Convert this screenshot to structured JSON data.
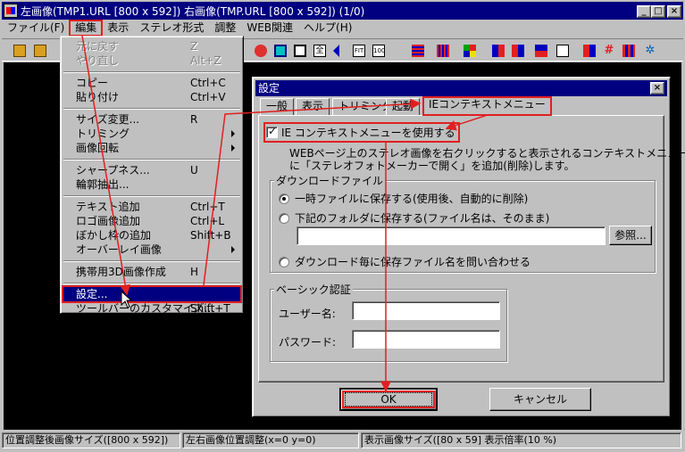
{
  "window": {
    "title": "左画像(TMP1.URL [800 x 592]) 右画像(TMP.URL [800 x 592]) (1/0)",
    "minimize": "_",
    "maximize": "□",
    "close": "×"
  },
  "menubar": [
    "ファイル(F)",
    "編集",
    "表示",
    "ステレオ形式",
    "調整",
    "WEB関連",
    "ヘルプ(H)"
  ],
  "edit_menu": {
    "undo": {
      "label": "元に戻す",
      "shortcut": "Z"
    },
    "redo": {
      "label": "やり直し",
      "shortcut": "Alt+Z"
    },
    "copy": {
      "label": "コピー",
      "shortcut": "Ctrl+C"
    },
    "paste": {
      "label": "貼り付け",
      "shortcut": "Ctrl+V"
    },
    "resize": {
      "label": "サイズ変更...",
      "shortcut": "R"
    },
    "trimming": {
      "label": "トリミング"
    },
    "rotate": {
      "label": "画像回転"
    },
    "sharpness": {
      "label": "シャープネス...",
      "shortcut": "U"
    },
    "contour": {
      "label": "輪郭抽出..."
    },
    "text_add": {
      "label": "テキスト追加",
      "shortcut": "Ctrl+T"
    },
    "logo_add": {
      "label": "ロゴ画像追加",
      "shortcut": "Ctrl+L"
    },
    "blur_frame": {
      "label": "ぼかし枠の追加",
      "shortcut": "Shift+B"
    },
    "overlay": {
      "label": "オーバーレイ画像"
    },
    "mobile3d": {
      "label": "携帯用3D画像作成",
      "shortcut": "H"
    },
    "settings": {
      "label": "設定..."
    },
    "customize": {
      "label": "ツールバーのカスタマイズ...",
      "shortcut": "Shift+T"
    }
  },
  "dialog": {
    "title": "設定",
    "close": "×",
    "tabs": [
      "一般",
      "表示",
      "トリミング",
      "起動",
      "IEコンテキストメニュー"
    ],
    "use_ie_menu": "IE コンテキストメニューを使用する",
    "desc1": "WEBページ上のステレオ画像を右クリックすると表示されるコンテキストメニュー",
    "desc2": "に「ステレオフォトメーカーで開く」を追加(削除)します。",
    "download_group": "ダウンロードファイル",
    "radio_temp": "一時ファイルに保存する(使用後、自動的に削除)",
    "radio_folder": "下記のフォルダに保存する(ファイル名は、そのまま)",
    "folder_value": "",
    "browse": "参照...",
    "radio_ask": "ダウンロード毎に保存ファイル名を問い合わせる",
    "basic_auth_group": "ベーシック認証",
    "username_label": "ユーザー名:",
    "username_value": "",
    "password_label": "パスワード:",
    "password_value": "",
    "ok": "OK",
    "cancel": "キャンセル"
  },
  "status": [
    "位置調整後画像サイズ([800 x 592])",
    "左右画像位置調整(x=0 y=0)",
    "表示画像サイズ([80 x 59] 表示倍率(10 %)"
  ],
  "colors": {
    "title_bar": "#000080",
    "annotation": "#e02020",
    "canvas": "#000000",
    "face": "#c0c0c0"
  }
}
